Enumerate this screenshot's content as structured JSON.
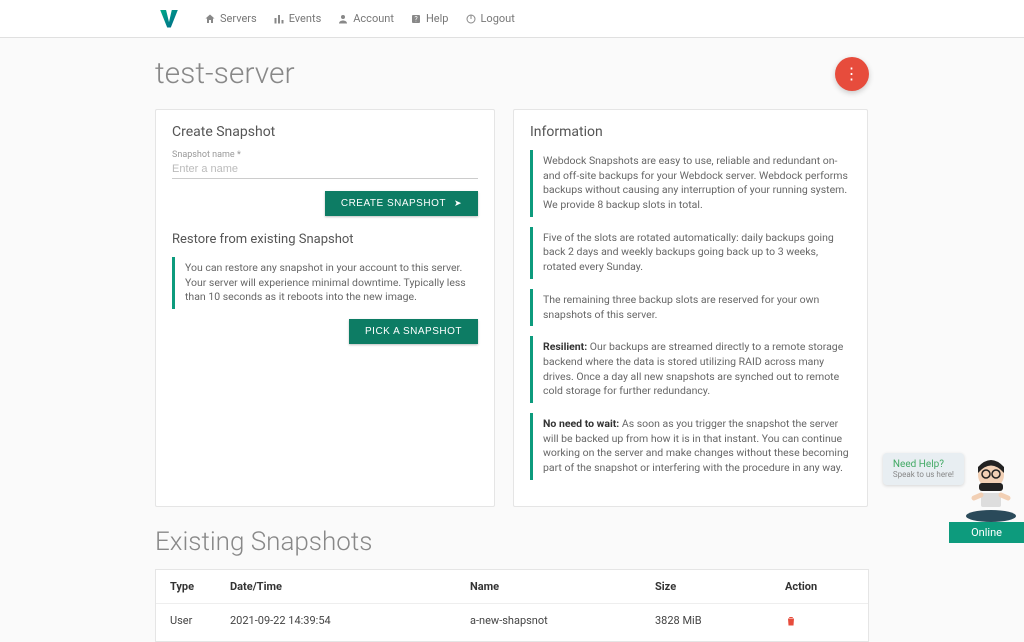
{
  "nav": {
    "servers": "Servers",
    "events": "Events",
    "account": "Account",
    "help": "Help",
    "logout": "Logout"
  },
  "page": {
    "title": "test-server",
    "existing_heading": "Existing Snapshots"
  },
  "create": {
    "heading": "Create Snapshot",
    "field_label": "Snapshot name *",
    "placeholder": "Enter a name",
    "button": "CREATE SNAPSHOT"
  },
  "restore": {
    "heading": "Restore from existing Snapshot",
    "desc": "You can restore any snapshot in your account to this server. Your server will experience minimal downtime. Typically less than 10 seconds as it reboots into the new image.",
    "button": "PICK A SNAPSHOT"
  },
  "info": {
    "heading": "Information",
    "p1": "Webdock Snapshots are easy to use, reliable and redundant on- and off-site backups for your Webdock server. Webdock performs backups without causing any interruption of your running system. We provide 8 backup slots in total.",
    "p2": "Five of the slots are rotated automatically: daily backups going back 2 days and weekly backups going back up to 3 weeks, rotated every Sunday.",
    "p3": "The remaining three backup slots are reserved for your own snapshots of this server.",
    "p4_strong": "Resilient:",
    "p4": " Our backups are streamed directly to a remote storage backend where the data is stored utilizing RAID across many drives. Once a day all new snapshots are synched out to remote cold storage for further redundancy.",
    "p5_strong": "No need to wait:",
    "p5": " As soon as you trigger the snapshot the server will be backed up from how it is in that instant. You can continue working on the server and make changes without these becoming part of the snapshot or interfering with the procedure in any way."
  },
  "table": {
    "headers": {
      "type": "Type",
      "date": "Date/Time",
      "name": "Name",
      "size": "Size",
      "action": "Action"
    },
    "rows": [
      {
        "type": "User",
        "date": "2021-09-22 14:39:54",
        "name": "a-new-shapsnot",
        "size": "3828 MiB"
      }
    ]
  },
  "chat": {
    "title": "Need Help?",
    "sub": "Speak to us here!",
    "status": "Online"
  }
}
